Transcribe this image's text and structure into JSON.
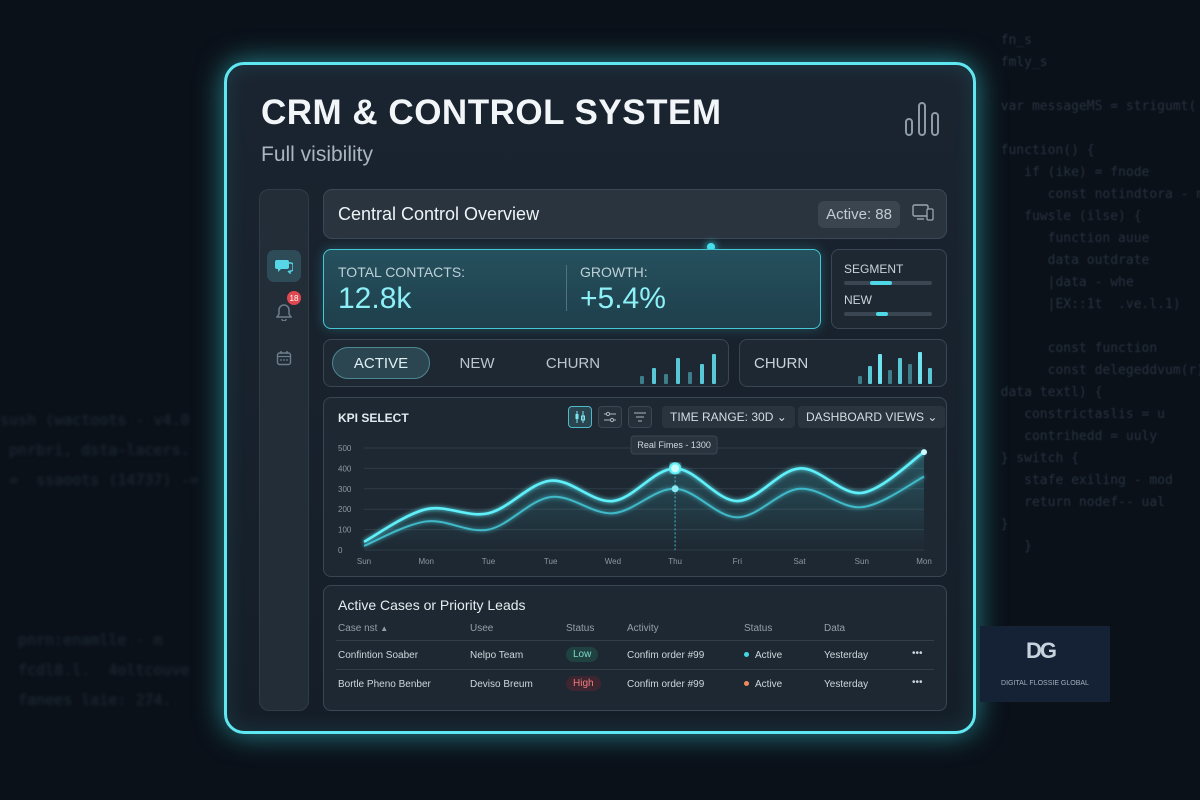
{
  "app": {
    "title": "CRM & CONTROL SYSTEM",
    "subtitle": "Full visibility"
  },
  "sidebar": {
    "items": [
      {
        "icon": "chat-icon",
        "active": true
      },
      {
        "icon": "bell-icon",
        "badge": "18"
      },
      {
        "icon": "calendar-icon"
      }
    ]
  },
  "header": {
    "title": "Central Control Overview",
    "active_label": "Active: 88"
  },
  "kpis": {
    "total_label": "TOTAL CONTACTS:",
    "total_value": "12.8k",
    "growth_label": "GROWTH:",
    "growth_value": "+5.4%"
  },
  "segments": {
    "segment_label": "SEGMENT",
    "new_label": "NEW"
  },
  "tabs": {
    "items": [
      "ACTIVE",
      "NEW",
      "CHURN"
    ],
    "selected": "ACTIVE"
  },
  "churn": {
    "label": "CHURN"
  },
  "chart": {
    "title": "KPI SELECT",
    "time_range": "TIME RANGE: 30D",
    "views": "DASHBOARD VIEWS",
    "tooltip": "Real Fimes - 1300"
  },
  "chart_data": {
    "type": "line",
    "categories": [
      "Sun",
      "Mon",
      "Tue",
      "Tue",
      "Wed",
      "Thu",
      "Fri",
      "Sat",
      "Sun",
      "Mon"
    ],
    "ylim": [
      0,
      500
    ],
    "yticks": [
      0,
      100,
      200,
      300,
      400,
      500
    ],
    "series": [
      {
        "values": [
          40,
          200,
          180,
          340,
          240,
          400,
          240,
          400,
          280,
          480
        ]
      },
      {
        "values": [
          20,
          140,
          100,
          260,
          180,
          300,
          160,
          300,
          210,
          360
        ]
      }
    ]
  },
  "table": {
    "title": "Active Cases or Priority Leads",
    "columns": [
      "Case nst",
      "Usee",
      "Status",
      "Activity",
      "Status",
      "Data"
    ],
    "rows": [
      {
        "name": "Confintion Soaber",
        "user": "Nelpo Team",
        "priority": "Low",
        "activity": "Confim order #99",
        "status": "Active",
        "date": "Yesterday",
        "more": "•••"
      },
      {
        "name": "Bortle Pheno Benber",
        "user": "Deviso Breum",
        "priority": "High",
        "activity": "Confim order #99",
        "status": "Active",
        "date": "Yesterday",
        "more": "•••"
      }
    ]
  },
  "logo": {
    "mark": "DG",
    "text": "DIGITAL FLOSSIE GLOBAL"
  },
  "colors": {
    "accent": "#5fe8f2",
    "kpi_value": "#8df0f7",
    "high": "#f07b7f",
    "low": "#7fd9c8"
  }
}
